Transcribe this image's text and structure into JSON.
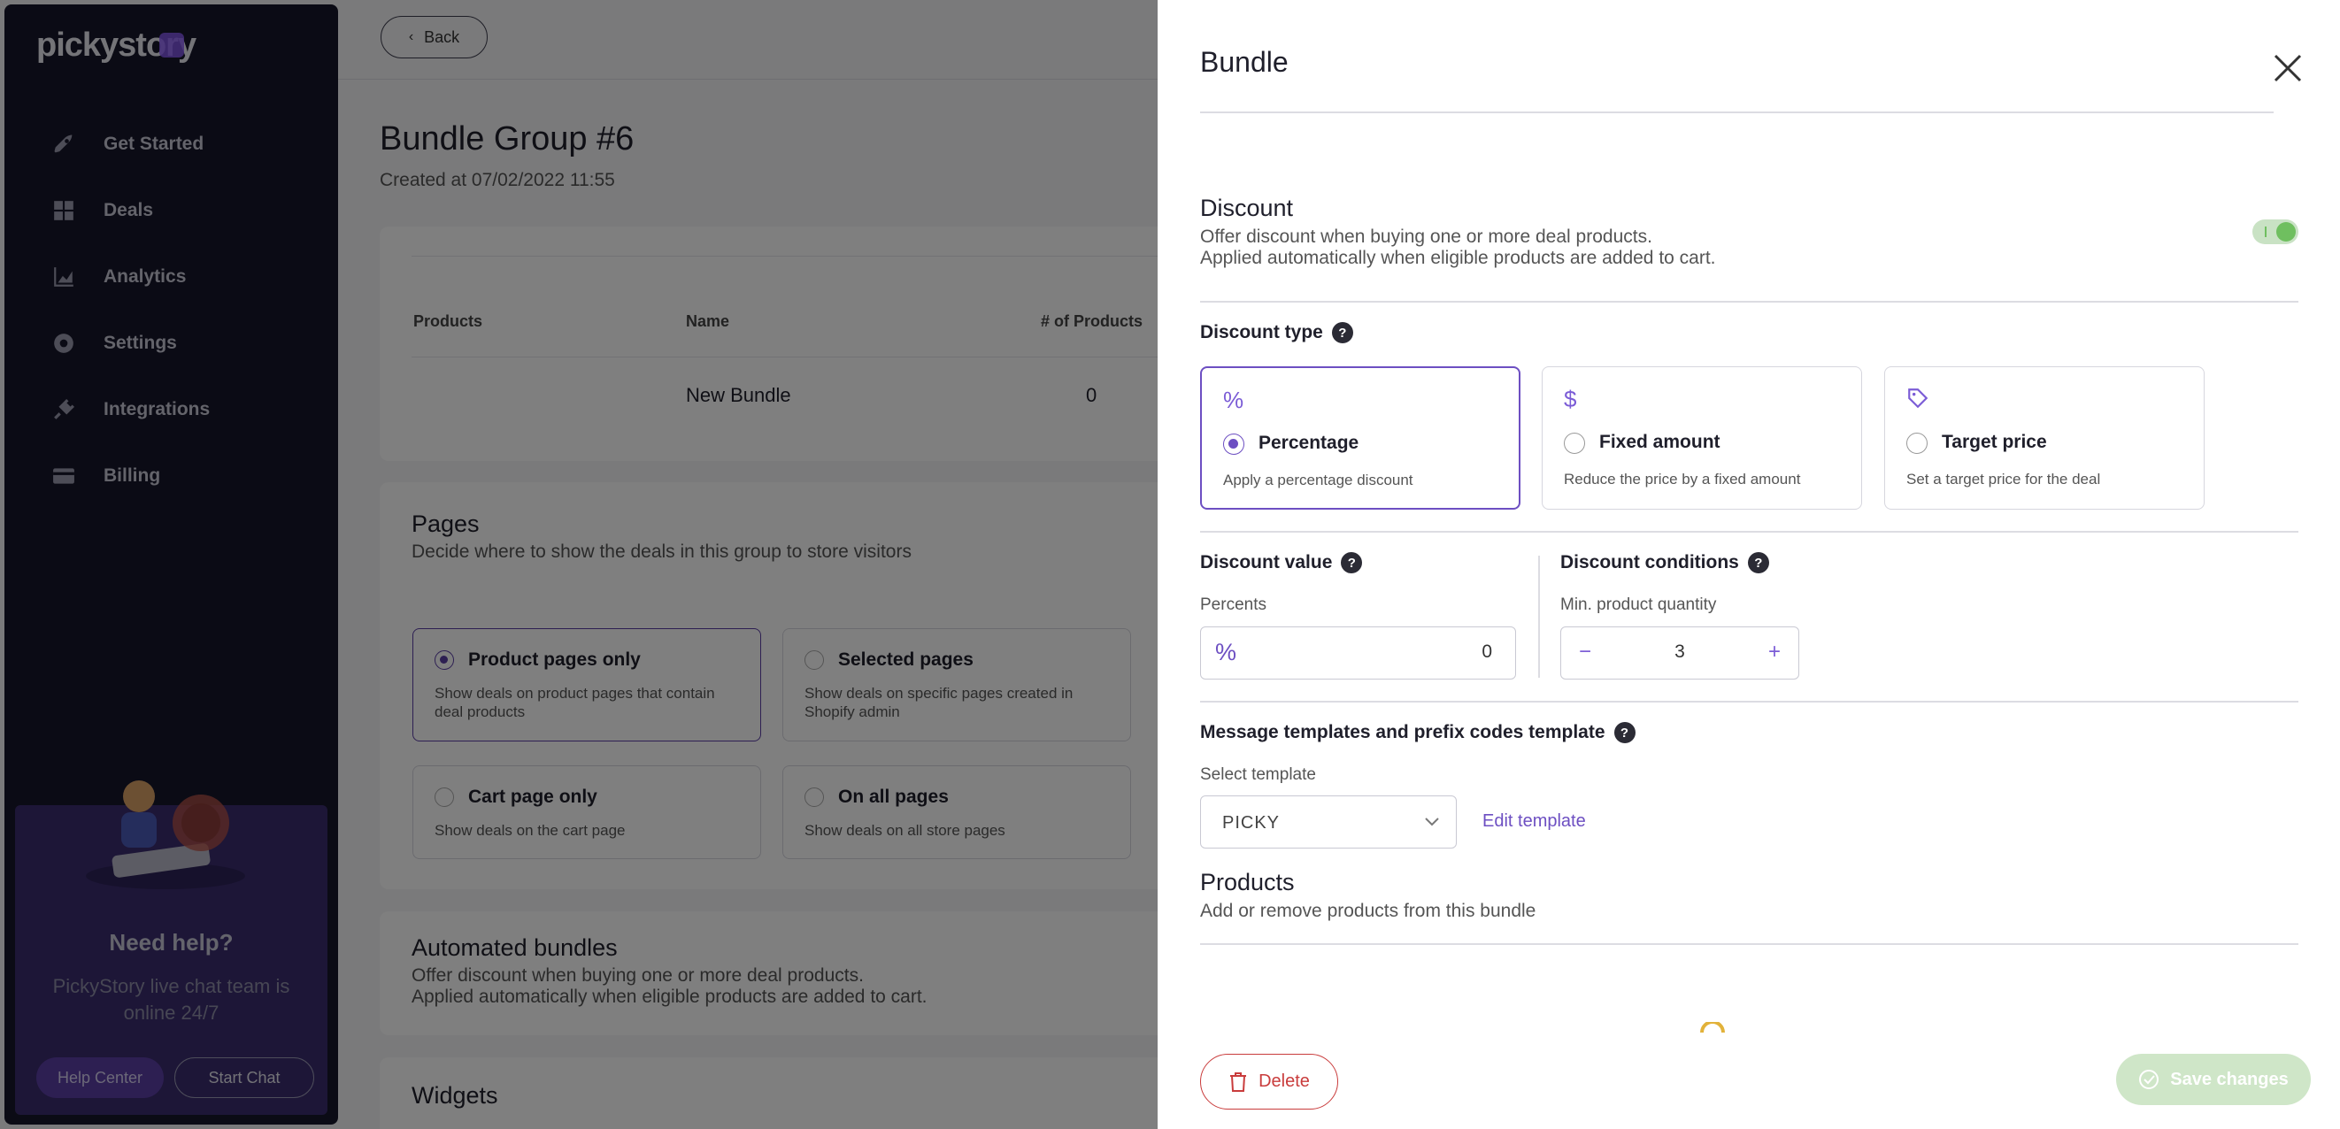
{
  "sidebar": {
    "logo": "pickystory",
    "items": [
      {
        "label": "Get Started",
        "icon": "rocket-icon"
      },
      {
        "label": "Deals",
        "icon": "grid-icon"
      },
      {
        "label": "Analytics",
        "icon": "chart-icon"
      },
      {
        "label": "Settings",
        "icon": "gear-icon"
      },
      {
        "label": "Integrations",
        "icon": "plug-icon"
      },
      {
        "label": "Billing",
        "icon": "card-icon"
      }
    ],
    "help": {
      "title": "Need help?",
      "subtitle": "PickyStory live chat team is online 24/7",
      "help_center": "Help Center",
      "start_chat": "Start Chat"
    }
  },
  "main": {
    "back_label": "Back",
    "title": "Bundle Group #6",
    "created": "Created at 07/02/2022 11:55",
    "table": {
      "columns": [
        "Products",
        "Name",
        "# of Products"
      ],
      "rows": [
        {
          "name": "New Bundle",
          "count": "0"
        }
      ]
    },
    "pages": {
      "title": "Pages",
      "subtitle": "Decide where to show the deals in this group to store visitors",
      "options": [
        {
          "title": "Product pages only",
          "desc": "Show deals on product pages that contain deal products",
          "selected": true
        },
        {
          "title": "Selected pages",
          "desc": "Show deals on specific pages created in Shopify admin",
          "selected": false
        },
        {
          "title": "Cart page only",
          "desc": "Show deals on the cart page",
          "selected": false
        },
        {
          "title": "On all pages",
          "desc": "Show deals on all store pages",
          "selected": false
        }
      ]
    },
    "automated": {
      "title": "Automated bundles",
      "subtitle_1": "Offer discount when buying one or more deal products.",
      "subtitle_2": "Applied automatically when eligible products are added to cart."
    },
    "widgets": {
      "title": "Widgets"
    }
  },
  "drawer": {
    "title": "Bundle",
    "discount": {
      "title": "Discount",
      "subtitle_1": "Offer discount when buying one or more deal products.",
      "subtitle_2": "Applied automatically when eligible products are added to cart.",
      "enabled": true
    },
    "discount_type": {
      "label": "Discount type",
      "options": [
        {
          "icon": "percent-icon",
          "title": "Percentage",
          "desc": "Apply a percentage discount",
          "selected": true
        },
        {
          "icon": "dollar-icon",
          "title": "Fixed amount",
          "desc": "Reduce the price by a fixed amount",
          "selected": false
        },
        {
          "icon": "tag-icon",
          "title": "Target price",
          "desc": "Set a target price for the deal",
          "selected": false
        }
      ]
    },
    "discount_value": {
      "label": "Discount value",
      "field_label": "Percents",
      "prefix": "%",
      "value": "0"
    },
    "discount_conditions": {
      "label": "Discount conditions",
      "field_label": "Min. product quantity",
      "value": "3"
    },
    "templates": {
      "label": "Message templates and prefix codes template",
      "field_label": "Select template",
      "selected": "PICKY",
      "edit_label": "Edit template"
    },
    "products": {
      "title": "Products",
      "subtitle": "Add or remove products from this bundle"
    },
    "delete_label": "Delete",
    "save_label": "Save changes",
    "colors": {
      "accent": "#6d4fc2",
      "danger": "#c93c3c",
      "success": "#6fbf5f"
    }
  }
}
